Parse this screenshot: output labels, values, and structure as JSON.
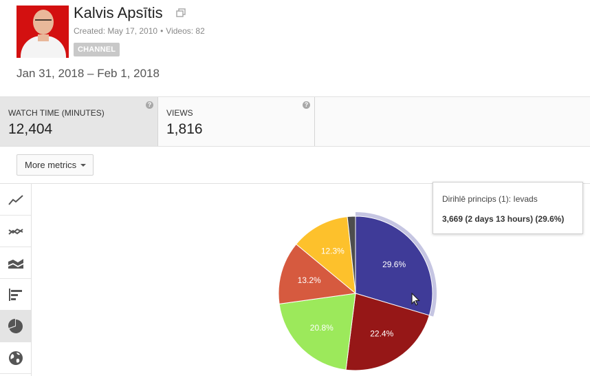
{
  "channel": {
    "name": "Kalvis Apsītis",
    "created": "Created: May 17, 2010",
    "separator": "•",
    "videos": "Videos: 82",
    "badge": "CHANNEL"
  },
  "date_range": "Jan 31, 2018 – Feb 1, 2018",
  "metrics": [
    {
      "label": "WATCH TIME (MINUTES)",
      "value": "12,404",
      "selected": true
    },
    {
      "label": "VIEWS",
      "value": "1,816",
      "selected": false
    }
  ],
  "help_glyph": "?",
  "more_metrics_label": "More metrics",
  "chart_tabs": [
    {
      "icon": "line-chart-icon",
      "selected": false
    },
    {
      "icon": "multi-line-chart-icon",
      "selected": false
    },
    {
      "icon": "stacked-area-chart-icon",
      "selected": false
    },
    {
      "icon": "bar-chart-icon",
      "selected": false
    },
    {
      "icon": "pie-chart-icon",
      "selected": true
    },
    {
      "icon": "globe-map-icon",
      "selected": false
    }
  ],
  "tooltip": {
    "title": "Dirihlē princips (1): Ievads",
    "value": "3,669 (2 days 13 hours) (29.6%)"
  },
  "chart_data": {
    "type": "pie",
    "slices": [
      {
        "label": "29.6%",
        "value": 29.6,
        "color": "#3f3b98",
        "highlighted": true
      },
      {
        "label": "22.4%",
        "value": 22.4,
        "color": "#961717"
      },
      {
        "label": "20.8%",
        "value": 20.8,
        "color": "#9ce95b"
      },
      {
        "label": "13.2%",
        "value": 13.2,
        "color": "#d65a3f"
      },
      {
        "label": "12.3%",
        "value": 12.3,
        "color": "#fdc12c"
      },
      {
        "label": "",
        "value": 1.7,
        "color": "#4d4d4d"
      }
    ],
    "highlight_color": "#c5c5e2",
    "label_color": "#ffffff"
  }
}
